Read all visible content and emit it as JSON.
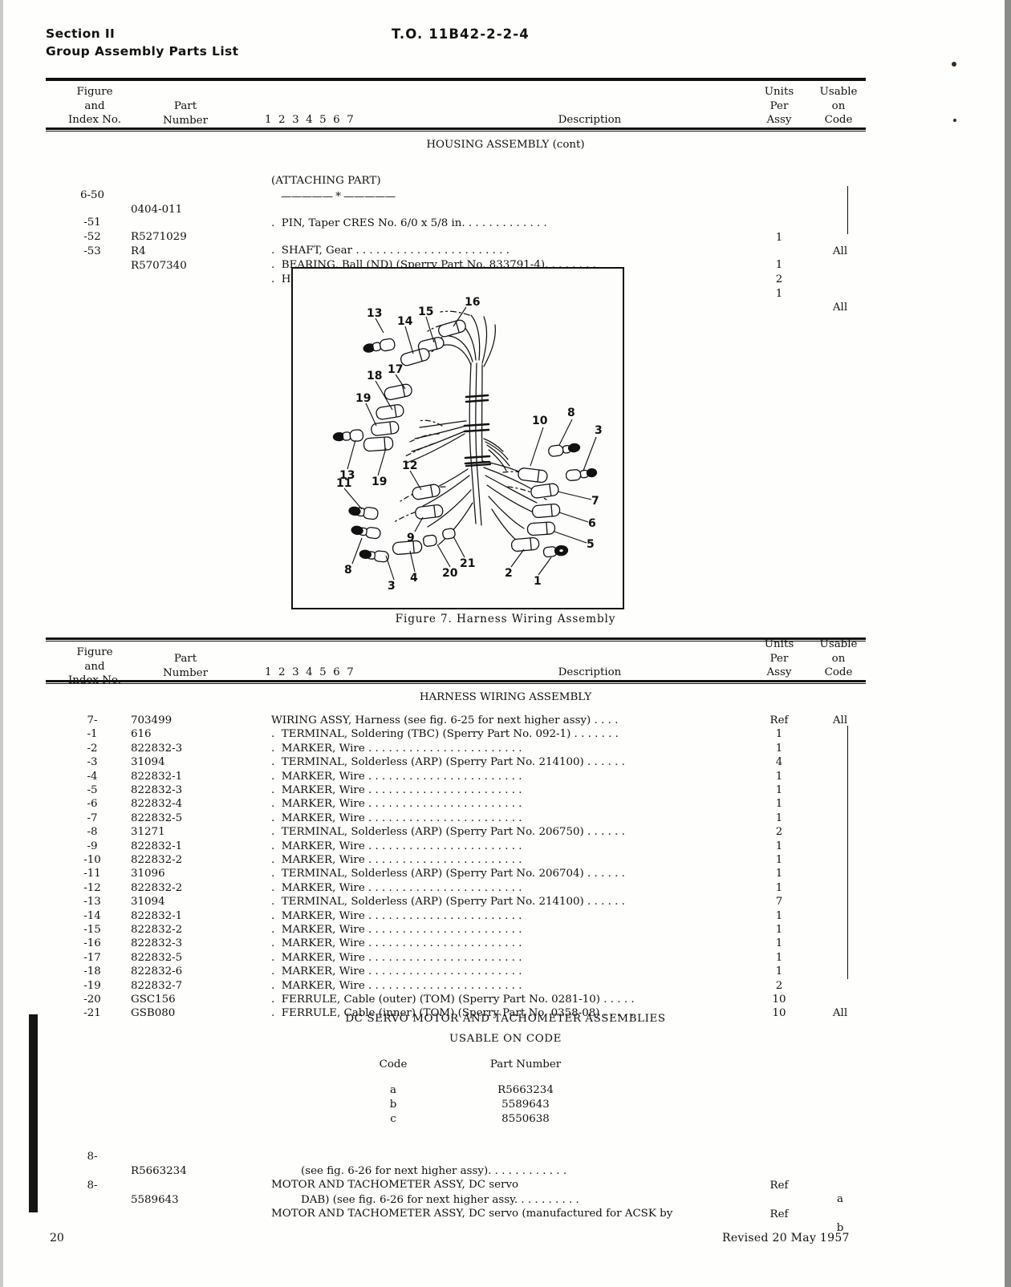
{
  "header": {
    "section": "Section II",
    "subtitle": "Group Assembly Parts List",
    "to_number": "T.O. 11B42-2-2-4"
  },
  "table_header": {
    "figure_and_index": "Figure\nand\nIndex No.",
    "part_number": "Part\nNumber",
    "level_numbers": "1  2  3  4  5  6  7",
    "description": "Description",
    "units_per_assy": "Units\nPer\nAssy",
    "usable_on_code": "Usable\non\nCode"
  },
  "table1": {
    "group_title": "HOUSING ASSEMBLY (cont)",
    "attaching_part_label": "(ATTACHING PART)",
    "separator": "————— * —————",
    "rows": [
      {
        "index": "6-50",
        "part": "0404-011",
        "desc": ".  PIN, Taper CRES No. 6/0 x 5/8 in. . . . . . . . . . . . .",
        "units": "1",
        "code": "All"
      },
      {
        "index": "-51",
        "part": "R5271029",
        "desc": ".  SHAFT, Gear . . . . . . . . . . . . . . . . . . . . . . .",
        "units": "1",
        "code": ""
      },
      {
        "index": "-52",
        "part": "R4",
        "desc": ".  BEARING, Ball (ND) (Sperry Part No. 833791-4). . . . . . . .",
        "units": "2",
        "code": ""
      },
      {
        "index": "-53",
        "part": "R5707340",
        "desc": ".  HOUSING . . . . . . . . . . . . . . . . . . . . . . . . .",
        "units": "1",
        "code": "All"
      }
    ]
  },
  "figure": {
    "caption": "Figure 7.   Harness Wiring Assembly",
    "callouts": [
      "13",
      "14",
      "15",
      "16",
      "17",
      "18",
      "19",
      "13",
      "19",
      "12",
      "11",
      "8",
      "3",
      "4",
      "9",
      "20",
      "21",
      "2",
      "1",
      "5",
      "6",
      "7",
      "8",
      "3",
      "10",
      "8"
    ]
  },
  "table2": {
    "group_title": "HARNESS WIRING ASSEMBLY",
    "rows": [
      {
        "index": "7-",
        "part": "703499",
        "desc": "WIRING ASSY, Harness (see fig. 6-25 for next higher assy) . . . .",
        "units": "Ref",
        "code": "All"
      },
      {
        "index": "-1",
        "part": "616",
        "desc": ".  TERMINAL, Soldering (TBC) (Sperry Part No. 092-1) . . . . . . .",
        "units": "1",
        "code": ""
      },
      {
        "index": "-2",
        "part": "822832-3",
        "desc": ".  MARKER, Wire . . . . . . . . . . . . . . . . . . . . . . .",
        "units": "1",
        "code": ""
      },
      {
        "index": "-3",
        "part": "31094",
        "desc": ".  TERMINAL, Solderless (ARP) (Sperry Part No. 214100) . . . . . .",
        "units": "4",
        "code": ""
      },
      {
        "index": "-4",
        "part": "822832-1",
        "desc": ".  MARKER, Wire . . . . . . . . . . . . . . . . . . . . . . .",
        "units": "1",
        "code": ""
      },
      {
        "index": "-5",
        "part": "822832-3",
        "desc": ".  MARKER, Wire . . . . . . . . . . . . . . . . . . . . . . .",
        "units": "1",
        "code": ""
      },
      {
        "index": "-6",
        "part": "822832-4",
        "desc": ".  MARKER, Wire . . . . . . . . . . . . . . . . . . . . . . .",
        "units": "1",
        "code": ""
      },
      {
        "index": "-7",
        "part": "822832-5",
        "desc": ".  MARKER, Wire . . . . . . . . . . . . . . . . . . . . . . .",
        "units": "1",
        "code": ""
      },
      {
        "index": "-8",
        "part": "31271",
        "desc": ".  TERMINAL, Solderless (ARP) (Sperry Part No. 206750) . . . . . .",
        "units": "2",
        "code": ""
      },
      {
        "index": "-9",
        "part": "822832-1",
        "desc": ".  MARKER, Wire . . . . . . . . . . . . . . . . . . . . . . .",
        "units": "1",
        "code": ""
      },
      {
        "index": "-10",
        "part": "822832-2",
        "desc": ".  MARKER, Wire . . . . . . . . . . . . . . . . . . . . . . .",
        "units": "1",
        "code": ""
      },
      {
        "index": "-11",
        "part": "31096",
        "desc": ".  TERMINAL, Solderless (ARP) (Sperry Part No. 206704) . . . . . .",
        "units": "1",
        "code": ""
      },
      {
        "index": "-12",
        "part": "822832-2",
        "desc": ".  MARKER, Wire . . . . . . . . . . . . . . . . . . . . . . .",
        "units": "1",
        "code": ""
      },
      {
        "index": "-13",
        "part": "31094",
        "desc": ".  TERMINAL, Solderless (ARP) (Sperry Part No. 214100) . . . . . .",
        "units": "7",
        "code": ""
      },
      {
        "index": "-14",
        "part": "822832-1",
        "desc": ".  MARKER, Wire . . . . . . . . . . . . . . . . . . . . . . .",
        "units": "1",
        "code": ""
      },
      {
        "index": "-15",
        "part": "822832-2",
        "desc": ".  MARKER, Wire . . . . . . . . . . . . . . . . . . . . . . .",
        "units": "1",
        "code": ""
      },
      {
        "index": "-16",
        "part": "822832-3",
        "desc": ".  MARKER, Wire . . . . . . . . . . . . . . . . . . . . . . .",
        "units": "1",
        "code": ""
      },
      {
        "index": "-17",
        "part": "822832-5",
        "desc": ".  MARKER, Wire . . . . . . . . . . . . . . . . . . . . . . .",
        "units": "1",
        "code": ""
      },
      {
        "index": "-18",
        "part": "822832-6",
        "desc": ".  MARKER, Wire . . . . . . . . . . . . . . . . . . . . . . .",
        "units": "1",
        "code": ""
      },
      {
        "index": "-19",
        "part": "822832-7",
        "desc": ".  MARKER, Wire . . . . . . . . . . . . . . . . . . . . . . .",
        "units": "2",
        "code": ""
      },
      {
        "index": "-20",
        "part": "GSC156",
        "desc": ".  FERRULE, Cable (outer) (TOM) (Sperry Part No. 0281-10) . . . . .",
        "units": "10",
        "code": ""
      },
      {
        "index": "-21",
        "part": "GSB080",
        "desc": ".  FERRULE, Cable (inner) (TOM) (Sperry Part No. 0358-08) . . . . .",
        "units": "10",
        "code": "All"
      }
    ]
  },
  "servo_section": {
    "title": "DC SERVO MOTOR AND TACHOMETER ASSEMBLIES",
    "subtitle": "USABLE ON CODE",
    "code_header": "Code",
    "part_header": "Part Number",
    "code_table": [
      {
        "code": "a",
        "part": "R5663234"
      },
      {
        "code": "b",
        "part": "5589643"
      },
      {
        "code": "c",
        "part": "8550638"
      }
    ],
    "rows": [
      {
        "index": "8-",
        "part": "R5663234",
        "desc_line1": "MOTOR AND TACHOMETER ASSY, DC servo",
        "desc_line2": "(see fig. 6-26 for next higher assy). . . . . . . . . . . .",
        "units": "Ref",
        "code": "a"
      },
      {
        "index": "8-",
        "part": "5589643",
        "desc_line1": "MOTOR AND TACHOMETER ASSY, DC servo (manufactured for ACSK by",
        "desc_line2": "DAB) (see fig. 6-26 for next higher assy. . . . . . . . . .",
        "units": "Ref",
        "code": "b"
      }
    ]
  },
  "footer": {
    "page_number": "20",
    "revision": "Revised 20 May 1957"
  }
}
